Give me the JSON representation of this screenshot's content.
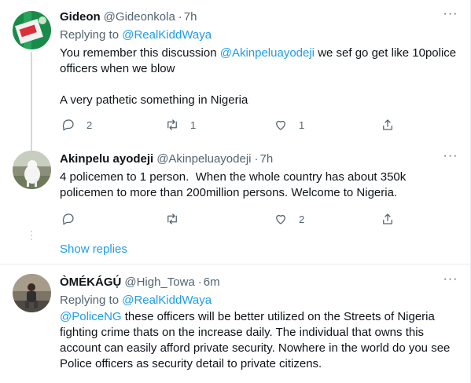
{
  "tweets": [
    {
      "name": "Gideon",
      "handle": "@Gideonkola",
      "separator": "·",
      "time": "7h",
      "replying_prefix": "Replying to",
      "replying_to": "@RealKiddWaya",
      "text_line1_prefix": "You remember this discussion ",
      "text_mention": "@Akinpeluayodeji",
      "text_line1_suffix": " we sef go get like 10police",
      "text_line2": "officers when we blow",
      "text_line3": "A very pathetic something in Nigeria",
      "reply_count": "2",
      "retweet_count": "1",
      "like_count": "1",
      "avatar_icon": "nigeria-flag-avatar",
      "avatar_colors": [
        "#1a8a4a",
        "#d9303a",
        "#ffffff"
      ]
    },
    {
      "name": "Akinpelu ayodeji",
      "handle": "@Akinpeluayodeji",
      "separator": "·",
      "time": "7h",
      "text_line1": "4 policemen to 1 person.  When the whole country has about 350k",
      "text_line2": "policemen to more than 200million persons. Welcome to Nigeria.",
      "reply_count": "",
      "retweet_count": "",
      "like_count": "2",
      "avatar_icon": "dog-photo-avatar"
    },
    {
      "name": "ÒMÉKÁGỤ́",
      "handle": "@High_Towa",
      "separator": "·",
      "time": "6m",
      "replying_prefix": "Replying to",
      "replying_to": "@RealKiddWaya",
      "text_mention": "@PoliceNG",
      "text_line1_suffix": " these officers will be better utilized on the Streets of Nigeria",
      "text_line2": "fighting crime thats on the increase daily. The individual that owns this",
      "text_line3": "account can easily afford private security. Nowhere in the world do you see",
      "text_line4": "Police officers as security detail to private citizens.",
      "avatar_icon": "person-photo-avatar"
    }
  ],
  "show_replies": "Show replies",
  "more_glyph": "···",
  "colors": {
    "link": "#1d9bf0",
    "muted": "#536471",
    "text": "#0f1419",
    "divider": "#e6ecf0"
  }
}
